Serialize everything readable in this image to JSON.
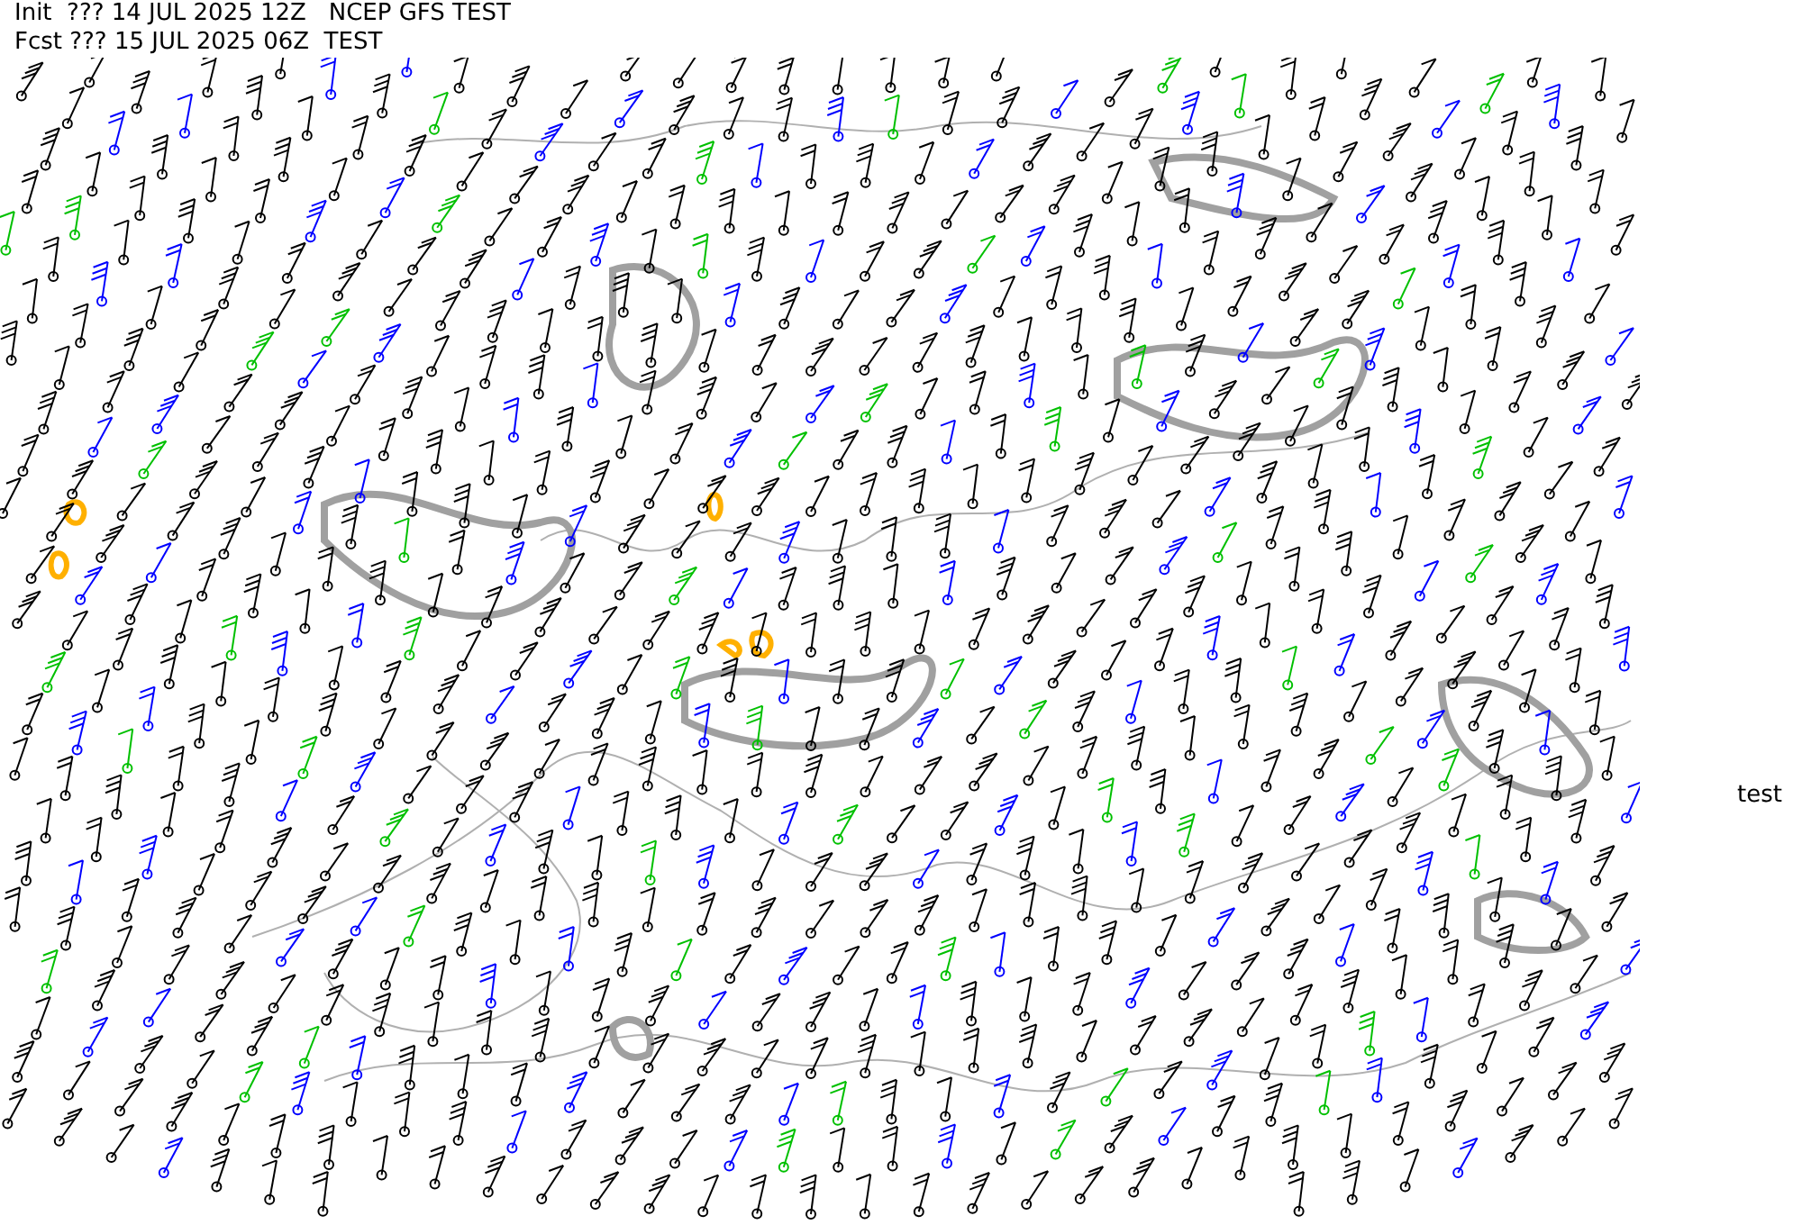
{
  "header": {
    "init_line": "Init  ??? 14 JUL 2025 12Z   NCEP GFS TEST",
    "forecast_line": "Fcst ??? 15 JUL 2025 06Z  TEST"
  },
  "side_label": "test"
}
